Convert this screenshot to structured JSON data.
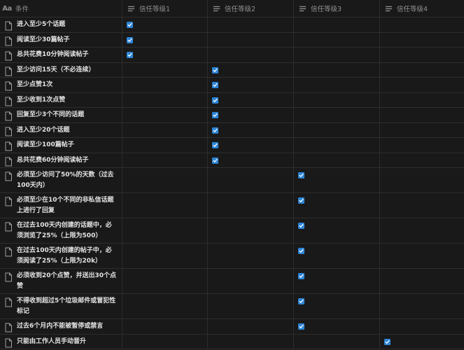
{
  "header": {
    "name_col": "条件",
    "name_icon": "text-property-icon",
    "name_icon_text": "Aa",
    "levels": [
      "信任等级1",
      "信任等级2",
      "信任等级3",
      "信任等级4"
    ],
    "level_icon": "list-property-icon"
  },
  "rows": [
    {
      "name": "进入至少5个话题",
      "checks": [
        true,
        false,
        false,
        false
      ]
    },
    {
      "name": "阅读至少30篇帖子",
      "checks": [
        true,
        false,
        false,
        false
      ]
    },
    {
      "name": "总共花费10分钟阅读帖子",
      "checks": [
        true,
        false,
        false,
        false
      ]
    },
    {
      "name": "至少访问15天（不必连续）",
      "checks": [
        false,
        true,
        false,
        false
      ]
    },
    {
      "name": "至少点赞1次",
      "checks": [
        false,
        true,
        false,
        false
      ]
    },
    {
      "name": "至少收到1次点赞",
      "checks": [
        false,
        true,
        false,
        false
      ]
    },
    {
      "name": "回复至少3个不同的话题",
      "checks": [
        false,
        true,
        false,
        false
      ]
    },
    {
      "name": "进入至少20个话题",
      "checks": [
        false,
        true,
        false,
        false
      ]
    },
    {
      "name": "阅读至少100篇帖子",
      "checks": [
        false,
        true,
        false,
        false
      ]
    },
    {
      "name": "总共花费60分钟阅读帖子",
      "checks": [
        false,
        true,
        false,
        false
      ]
    },
    {
      "name": "必须至少访问了50%的天数（过去100天内）",
      "checks": [
        false,
        false,
        true,
        false
      ]
    },
    {
      "name": "必须至少在10个不同的非私信话题上进行了回复",
      "checks": [
        false,
        false,
        true,
        false
      ]
    },
    {
      "name": "在过去100天内创建的话题中，必须浏览了25%（上限为500）",
      "checks": [
        false,
        false,
        true,
        false
      ]
    },
    {
      "name": "在过去100天内创建的帖子中，必须阅读了25%（上限为20k）",
      "checks": [
        false,
        false,
        true,
        false
      ]
    },
    {
      "name": "必须收到20个点赞，并送出30个点赞",
      "checks": [
        false,
        false,
        true,
        false
      ]
    },
    {
      "name": "不得收到超过5个垃圾邮件或冒犯性标记",
      "checks": [
        false,
        false,
        true,
        false
      ]
    },
    {
      "name": "过去6个月内不能被暂停或禁言",
      "checks": [
        false,
        false,
        true,
        false
      ]
    },
    {
      "name": "只能由工作人员手动晋升",
      "checks": [
        false,
        false,
        false,
        true
      ]
    }
  ],
  "row_icon": "page-icon",
  "check_icon": "checkbox-checked-icon",
  "colors": {
    "background": "#191919",
    "checkbox": "#2e86d8",
    "border": "#2d2d2d"
  }
}
